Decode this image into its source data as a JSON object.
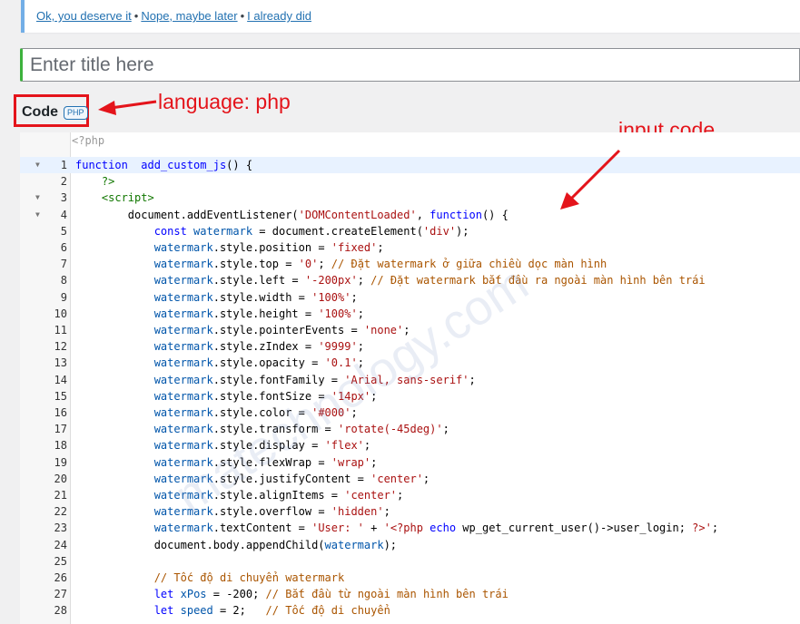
{
  "notice": {
    "links": [
      "Ok, you deserve it",
      "Nope, maybe later",
      "I already did"
    ],
    "separator": "•"
  },
  "title_field": {
    "placeholder": "Enter title here",
    "value": ""
  },
  "code_block": {
    "label": "Code",
    "language_badge": "PHP"
  },
  "annotations": {
    "language": "language: php",
    "input": "input code",
    "color": "#e4141b"
  },
  "watermark_overlay": "matechnology.com",
  "editor": {
    "php_open_tag": "<?php",
    "active_line": 1,
    "lines": [
      {
        "n": "1",
        "fold": true,
        "tokens": [
          [
            "kw",
            "function"
          ],
          [
            "",
            "  "
          ],
          [
            "def",
            "add_custom_js"
          ],
          [
            "",
            "() {"
          ]
        ]
      },
      {
        "n": "2",
        "fold": false,
        "tokens": [
          [
            "",
            "    "
          ],
          [
            "tag",
            "?>"
          ]
        ]
      },
      {
        "n": "3",
        "fold": true,
        "tokens": [
          [
            "",
            "    "
          ],
          [
            "tag",
            "<script>"
          ]
        ]
      },
      {
        "n": "4",
        "fold": true,
        "tokens": [
          [
            "",
            "        document.addEventListener("
          ],
          [
            "str",
            "'DOMContentLoaded'"
          ],
          [
            "",
            ", "
          ],
          [
            "kw",
            "function"
          ],
          [
            "",
            "() {"
          ]
        ]
      },
      {
        "n": "5",
        "fold": false,
        "tokens": [
          [
            "",
            "            "
          ],
          [
            "kw",
            "const"
          ],
          [
            "",
            ""
          ],
          [
            "var",
            " watermark"
          ],
          [
            "",
            " = document.createElement("
          ],
          [
            "str",
            "'div'"
          ],
          [
            "",
            ");"
          ]
        ]
      },
      {
        "n": "6",
        "fold": false,
        "tokens": [
          [
            "",
            "            "
          ],
          [
            "var",
            "watermark"
          ],
          [
            "",
            ".style.position = "
          ],
          [
            "str",
            "'fixed'"
          ],
          [
            "",
            ";"
          ]
        ]
      },
      {
        "n": "7",
        "fold": false,
        "tokens": [
          [
            "",
            "            "
          ],
          [
            "var",
            "watermark"
          ],
          [
            "",
            ".style.top = "
          ],
          [
            "str",
            "'0'"
          ],
          [
            "",
            "; "
          ],
          [
            "cm",
            "// Đặt watermark ở giữa chiều dọc màn hình"
          ]
        ]
      },
      {
        "n": "8",
        "fold": false,
        "tokens": [
          [
            "",
            "            "
          ],
          [
            "var",
            "watermark"
          ],
          [
            "",
            ".style.left = "
          ],
          [
            "str",
            "'-200px'"
          ],
          [
            "",
            "; "
          ],
          [
            "cm",
            "// Đặt watermark bắt đầu ra ngoài màn hình bên trái"
          ]
        ]
      },
      {
        "n": "9",
        "fold": false,
        "tokens": [
          [
            "",
            "            "
          ],
          [
            "var",
            "watermark"
          ],
          [
            "",
            ".style.width = "
          ],
          [
            "str",
            "'100%'"
          ],
          [
            "",
            ";"
          ]
        ]
      },
      {
        "n": "10",
        "fold": false,
        "tokens": [
          [
            "",
            "            "
          ],
          [
            "var",
            "watermark"
          ],
          [
            "",
            ".style.height = "
          ],
          [
            "str",
            "'100%'"
          ],
          [
            "",
            ";"
          ]
        ]
      },
      {
        "n": "11",
        "fold": false,
        "tokens": [
          [
            "",
            "            "
          ],
          [
            "var",
            "watermark"
          ],
          [
            "",
            ".style.pointerEvents = "
          ],
          [
            "str",
            "'none'"
          ],
          [
            "",
            ";"
          ]
        ]
      },
      {
        "n": "12",
        "fold": false,
        "tokens": [
          [
            "",
            "            "
          ],
          [
            "var",
            "watermark"
          ],
          [
            "",
            ".style.zIndex = "
          ],
          [
            "str",
            "'9999'"
          ],
          [
            "",
            ";"
          ]
        ]
      },
      {
        "n": "13",
        "fold": false,
        "tokens": [
          [
            "",
            "            "
          ],
          [
            "var",
            "watermark"
          ],
          [
            "",
            ".style.opacity = "
          ],
          [
            "str",
            "'0.1'"
          ],
          [
            "",
            ";"
          ]
        ]
      },
      {
        "n": "14",
        "fold": false,
        "tokens": [
          [
            "",
            "            "
          ],
          [
            "var",
            "watermark"
          ],
          [
            "",
            ".style.fontFamily = "
          ],
          [
            "str",
            "'Arial, sans-serif'"
          ],
          [
            "",
            ";"
          ]
        ]
      },
      {
        "n": "15",
        "fold": false,
        "tokens": [
          [
            "",
            "            "
          ],
          [
            "var",
            "watermark"
          ],
          [
            "",
            ".style.fontSize = "
          ],
          [
            "str",
            "'14px'"
          ],
          [
            "",
            ";"
          ]
        ]
      },
      {
        "n": "16",
        "fold": false,
        "tokens": [
          [
            "",
            "            "
          ],
          [
            "var",
            "watermark"
          ],
          [
            "",
            ".style.color = "
          ],
          [
            "str",
            "'#000'"
          ],
          [
            "",
            ";"
          ]
        ]
      },
      {
        "n": "17",
        "fold": false,
        "tokens": [
          [
            "",
            "            "
          ],
          [
            "var",
            "watermark"
          ],
          [
            "",
            ".style.transform = "
          ],
          [
            "str",
            "'rotate(-45deg)'"
          ],
          [
            "",
            ";"
          ]
        ]
      },
      {
        "n": "18",
        "fold": false,
        "tokens": [
          [
            "",
            "            "
          ],
          [
            "var",
            "watermark"
          ],
          [
            "",
            ".style.display = "
          ],
          [
            "str",
            "'flex'"
          ],
          [
            "",
            ";"
          ]
        ]
      },
      {
        "n": "19",
        "fold": false,
        "tokens": [
          [
            "",
            "            "
          ],
          [
            "var",
            "watermark"
          ],
          [
            "",
            ".style.flexWrap = "
          ],
          [
            "str",
            "'wrap'"
          ],
          [
            "",
            ";"
          ]
        ]
      },
      {
        "n": "20",
        "fold": false,
        "tokens": [
          [
            "",
            "            "
          ],
          [
            "var",
            "watermark"
          ],
          [
            "",
            ".style.justifyContent = "
          ],
          [
            "str",
            "'center'"
          ],
          [
            "",
            ";"
          ]
        ]
      },
      {
        "n": "21",
        "fold": false,
        "tokens": [
          [
            "",
            "            "
          ],
          [
            "var",
            "watermark"
          ],
          [
            "",
            ".style.alignItems = "
          ],
          [
            "str",
            "'center'"
          ],
          [
            "",
            ";"
          ]
        ]
      },
      {
        "n": "22",
        "fold": false,
        "tokens": [
          [
            "",
            "            "
          ],
          [
            "var",
            "watermark"
          ],
          [
            "",
            ".style.overflow = "
          ],
          [
            "str",
            "'hidden'"
          ],
          [
            "",
            ";"
          ]
        ]
      },
      {
        "n": "23",
        "fold": false,
        "tokens": [
          [
            "",
            "            "
          ],
          [
            "var",
            "watermark"
          ],
          [
            "",
            ".textContent = "
          ],
          [
            "str",
            "'User: '"
          ],
          [
            "",
            " + "
          ],
          [
            "str",
            "'<?php "
          ],
          [
            "kw",
            "echo"
          ],
          [
            "",
            " wp_get_current_user()->user_login; "
          ],
          [
            "str",
            "?>'"
          ],
          [
            "",
            ";"
          ]
        ]
      },
      {
        "n": "24",
        "fold": false,
        "tokens": [
          [
            "",
            "            document.body.appendChild("
          ],
          [
            "var",
            "watermark"
          ],
          [
            "",
            ");"
          ]
        ]
      },
      {
        "n": "25",
        "fold": false,
        "tokens": [
          [
            "",
            ""
          ]
        ]
      },
      {
        "n": "26",
        "fold": false,
        "tokens": [
          [
            "",
            "            "
          ],
          [
            "cm",
            "// Tốc độ di chuyển watermark"
          ]
        ]
      },
      {
        "n": "27",
        "fold": false,
        "tokens": [
          [
            "",
            "            "
          ],
          [
            "kw",
            "let"
          ],
          [
            "var",
            " xPos"
          ],
          [
            "",
            " = -200; "
          ],
          [
            "cm",
            "// Bắt đầu từ ngoài màn hình bên trái"
          ]
        ]
      },
      {
        "n": "28",
        "fold": false,
        "tokens": [
          [
            "",
            "            "
          ],
          [
            "kw",
            "let"
          ],
          [
            "var",
            " speed"
          ],
          [
            "",
            " = 2;   "
          ],
          [
            "cm",
            "// Tốc độ di chuyển"
          ]
        ]
      }
    ]
  }
}
